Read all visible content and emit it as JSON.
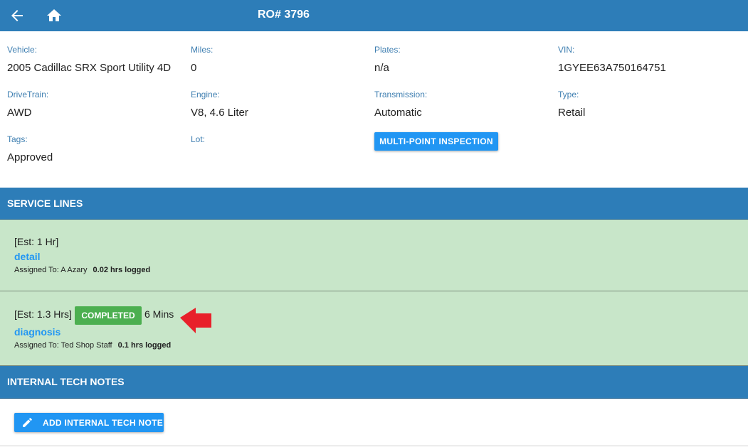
{
  "header": {
    "title": "RO# 3796",
    "back_icon": "arrow-left-icon",
    "home_icon": "home-icon"
  },
  "vehicle_info": {
    "vehicle": {
      "label": "Vehicle:",
      "value": "2005 Cadillac SRX Sport Utility 4D"
    },
    "miles": {
      "label": "Miles:",
      "value": "0"
    },
    "plates": {
      "label": "Plates:",
      "value": "n/a"
    },
    "vin": {
      "label": "VIN:",
      "value": "1GYEE63A750164751"
    },
    "drivetrain": {
      "label": "DriveTrain:",
      "value": "AWD"
    },
    "engine": {
      "label": "Engine:",
      "value": "V8, 4.6 Liter"
    },
    "transmission": {
      "label": "Transmission:",
      "value": "Automatic"
    },
    "type": {
      "label": "Type:",
      "value": "Retail"
    },
    "tags": {
      "label": "Tags:",
      "value": "Approved"
    },
    "lot": {
      "label": "Lot:",
      "value": ""
    },
    "mpi_button": "MULTI-POINT INSPECTION"
  },
  "service_lines": {
    "title": "SERVICE LINES",
    "items": [
      {
        "est": "[Est: 1 Hr]",
        "name": "detail",
        "assigned": "Assigned To: A Azary",
        "logged": "0.02 hrs logged"
      },
      {
        "est": "[Est: 1.3 Hrs]",
        "status": "COMPLETED",
        "duration": "6 Mins",
        "name": "diagnosis",
        "assigned": "Assigned To: Ted Shop Staff",
        "logged": "0.1 hrs logged"
      }
    ]
  },
  "internal_notes": {
    "title": "INTERNAL TECH NOTES",
    "add_button": "ADD INTERNAL TECH NOTE",
    "add_icon": "pencil-icon"
  },
  "colors": {
    "primary": "#2d7db8",
    "accent": "#2196f3",
    "service_bg": "#c8e6c9",
    "completed": "#4caf50",
    "arrow": "#e8202a"
  }
}
